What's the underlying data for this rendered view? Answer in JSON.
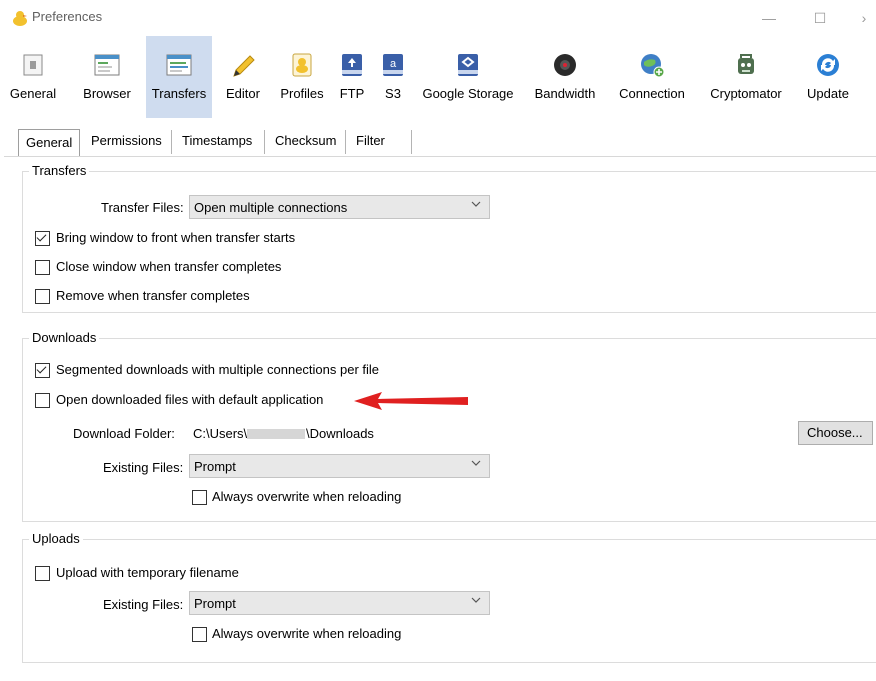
{
  "window": {
    "title": "Preferences"
  },
  "toolbar": {
    "items": [
      {
        "label": "General",
        "icon": "general-icon"
      },
      {
        "label": "Browser",
        "icon": "browser-icon"
      },
      {
        "label": "Transfers",
        "icon": "transfers-icon",
        "selected": true
      },
      {
        "label": "Editor",
        "icon": "pencil-icon"
      },
      {
        "label": "Profiles",
        "icon": "profiles-icon"
      },
      {
        "label": "FTP",
        "icon": "ftp-icon"
      },
      {
        "label": "S3",
        "icon": "s3-icon"
      },
      {
        "label": "Google Storage",
        "icon": "google-storage-icon"
      },
      {
        "label": "Bandwidth",
        "icon": "bandwidth-icon"
      },
      {
        "label": "Connection",
        "icon": "connection-icon"
      },
      {
        "label": "Cryptomator",
        "icon": "cryptomator-icon"
      },
      {
        "label": "Update",
        "icon": "update-icon"
      }
    ]
  },
  "tabs": [
    {
      "label": "General",
      "active": true
    },
    {
      "label": "Permissions"
    },
    {
      "label": "Timestamps"
    },
    {
      "label": "Checksum"
    },
    {
      "label": "Filter"
    }
  ],
  "transfers": {
    "title": "Transfers",
    "transfer_files_label": "Transfer Files:",
    "transfer_files_value": "Open multiple connections",
    "bring_to_front": {
      "label": "Bring window to front when transfer starts",
      "checked": true
    },
    "close_window": {
      "label": "Close window when transfer completes",
      "checked": false
    },
    "remove_when_complete": {
      "label": "Remove when transfer completes",
      "checked": false
    }
  },
  "downloads": {
    "title": "Downloads",
    "segmented": {
      "label": "Segmented downloads with multiple connections per file",
      "checked": true
    },
    "open_default": {
      "label": "Open downloaded files with default application",
      "checked": false
    },
    "folder_label": "Download Folder:",
    "folder_prefix": "C:\\Users\\",
    "folder_suffix": "\\Downloads",
    "choose_button": "Choose...",
    "existing_files_label": "Existing Files:",
    "existing_files_value": "Prompt",
    "always_overwrite": {
      "label": "Always overwrite when reloading",
      "checked": false
    }
  },
  "uploads": {
    "title": "Uploads",
    "temp_filename": {
      "label": "Upload with temporary filename",
      "checked": false
    },
    "existing_files_label": "Existing Files:",
    "existing_files_value": "Prompt",
    "always_overwrite": {
      "label": "Always overwrite when reloading",
      "checked": false
    }
  },
  "colors": {
    "accent_selected": "#cfdcef",
    "arrow": "#e02020"
  }
}
